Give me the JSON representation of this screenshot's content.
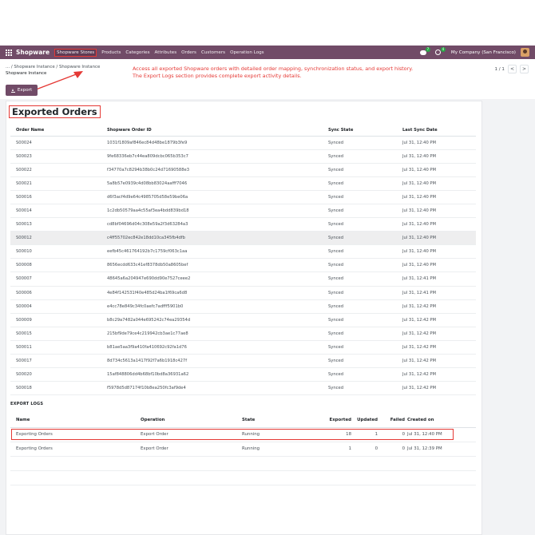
{
  "navbar": {
    "brand": "Shopware",
    "items": [
      "Shopware Stores",
      "Products",
      "Categories",
      "Attributes",
      "Orders",
      "Customers",
      "Operation Logs"
    ],
    "chat_badge": "7",
    "activity_badge": "4",
    "company": "My Company (San Francisco)"
  },
  "breadcrumb": {
    "path": "... / Shopware Instance / Shopware Instance",
    "current": "Shopware Instance"
  },
  "annotation": {
    "line1": "Access all exported Shopware orders with detailed order mapping, synchronization status, and export history.",
    "line2": "The Export Logs section provides complete export activity details."
  },
  "pager": {
    "value": "1 / 1",
    "prev": "<",
    "next": ">"
  },
  "export_button": "Export",
  "page_title": "Exported Orders",
  "orders": {
    "headers": [
      "Order Name",
      "Shopware Order ID",
      "Sync State",
      "Last Sync Date"
    ],
    "rows": [
      [
        "S00024",
        "1031f1809af846ec84d48be1879b3fe9",
        "Synced",
        "Jul 31, 12:40 PM"
      ],
      [
        "S00023",
        "9fe68336eb7c44ea809dcbc065b353c7",
        "Synced",
        "Jul 31, 12:40 PM"
      ],
      [
        "S00022",
        "f34770a7c8294b38b0c24d71690588e3",
        "Synced",
        "Jul 31, 12:40 PM"
      ],
      [
        "S00021",
        "5a8b57e0939c4d08bb83024aafff7046",
        "Synced",
        "Jul 31, 12:40 PM"
      ],
      [
        "S00016",
        "d6f3acf4d9e64c4985705d58e59be06a",
        "Synced",
        "Jul 31, 12:40 PM"
      ],
      [
        "S00014",
        "1c2db50579aa4c55af3ea4bdd839bd18",
        "Synced",
        "Jul 31, 12:40 PM"
      ],
      [
        "S00013",
        "cd8bf04696d04c308e59a2f3d63284a3",
        "Synced",
        "Jul 31, 12:40 PM"
      ],
      [
        "S00012",
        "c4ff55702ec842e18dd10ca345fb4dfb",
        "Synced",
        "Jul 31, 12:40 PM"
      ],
      [
        "S00010",
        "eefb45c461764192b7c1759cf063c1aa",
        "Synced",
        "Jul 31, 12:40 PM"
      ],
      [
        "S00008",
        "8656ecdd633c41ef8378db50a8605bef",
        "Synced",
        "Jul 31, 12:40 PM"
      ],
      [
        "S00007",
        "48645a6a204947e690dd90e7527ceee2",
        "Synced",
        "Jul 31, 12:41 PM"
      ],
      [
        "S00006",
        "4e84f142531f40e485d24ba1f69ca6d8",
        "Synced",
        "Jul 31, 12:41 PM"
      ],
      [
        "S00004",
        "e4cc78e849c34fc0aefc7adfff5901b0",
        "Synced",
        "Jul 31, 12:42 PM"
      ],
      [
        "S00009",
        "b8c29a7482a044e695242c74ea29354d",
        "Synced",
        "Jul 31, 12:42 PM"
      ],
      [
        "S00015",
        "215bf9de79ce4c219942cb3ae1c77ae8",
        "Synced",
        "Jul 31, 12:42 PM"
      ],
      [
        "S00011",
        "b81ae5aa3f9a410fa410692c92fa1d76",
        "Synced",
        "Jul 31, 12:42 PM"
      ],
      [
        "S00017",
        "8d734c5613a1417f92f7a6b1918c427f",
        "Synced",
        "Jul 31, 12:42 PM"
      ],
      [
        "S00020",
        "15af848806dd4b68bf10bd8a36931a62",
        "Synced",
        "Jul 31, 12:42 PM"
      ],
      [
        "S00018",
        "f5978d5d87174f10b8ea250fc3af9de4",
        "Synced",
        "Jul 31, 12:42 PM"
      ]
    ],
    "highlighted_index": 7
  },
  "export_logs": {
    "label": "EXPORT LOGS",
    "headers": [
      "Name",
      "Operation",
      "State",
      "Exported",
      "Updated",
      "Failed",
      "Created on"
    ],
    "rows": [
      [
        "Exporting Orders",
        "Export Order",
        "Running",
        "18",
        "1",
        "0",
        "Jul 31, 12:40 PM"
      ],
      [
        "Exporting Orders",
        "Export Order",
        "Running",
        "1",
        "0",
        "0",
        "Jul 31, 12:39 PM"
      ]
    ]
  },
  "colors": {
    "brand": "#714b67",
    "highlight": "#e53935"
  }
}
